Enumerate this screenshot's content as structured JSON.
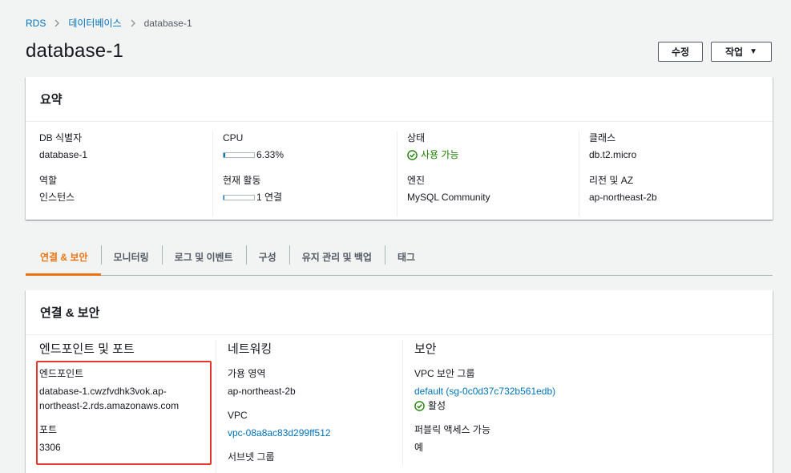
{
  "breadcrumb": {
    "root": "RDS",
    "section": "데이터베이스",
    "current": "database-1"
  },
  "page_title": "database-1",
  "actions": {
    "edit": "수정",
    "actions": "작업"
  },
  "summary": {
    "title": "요약",
    "db_id_label": "DB 식별자",
    "db_id_value": "database-1",
    "role_label": "역할",
    "role_value": "인스턴스",
    "cpu_label": "CPU",
    "cpu_value": "6.33%",
    "cpu_fraction": 0.0633,
    "activity_label": "현재 활동",
    "activity_value": "1 연결",
    "activity_fraction": 0.02,
    "status_label": "상태",
    "status_value": "사용 가능",
    "engine_label": "엔진",
    "engine_value": "MySQL Community",
    "class_label": "클래스",
    "class_value": "db.t2.micro",
    "region_label": "리전 및 AZ",
    "region_value": "ap-northeast-2b"
  },
  "tabs": [
    {
      "label": "연결 & 보안",
      "active": true
    },
    {
      "label": "모니터링",
      "active": false
    },
    {
      "label": "로그 및 이벤트",
      "active": false
    },
    {
      "label": "구성",
      "active": false
    },
    {
      "label": "유지 관리 및 백업",
      "active": false
    },
    {
      "label": "태그",
      "active": false
    }
  ],
  "connect": {
    "title": "연결 & 보안",
    "endpoint_section": "엔드포인트 및 포트",
    "endpoint_label": "엔드포인트",
    "endpoint_value": "database-1.cwzfvdhk3vok.ap-northeast-2.rds.amazonaws.com",
    "port_label": "포트",
    "port_value": "3306",
    "network_section": "네트워킹",
    "az_label": "가용 영역",
    "az_value": "ap-northeast-2b",
    "vpc_label": "VPC",
    "vpc_value": "vpc-08a8ac83d299ff512",
    "subnet_label": "서브넷 그룹",
    "security_section": "보안",
    "sg_label": "VPC 보안 그룹",
    "sg_value": "default (sg-0c0d37c732b561edb)",
    "sg_status": "활성",
    "public_label": "퍼블릭 액세스 가능",
    "public_value": "예"
  },
  "colors": {
    "accent": "#ec7211",
    "link": "#0073bb",
    "success": "#1d8102",
    "highlight": "#e8372c"
  }
}
